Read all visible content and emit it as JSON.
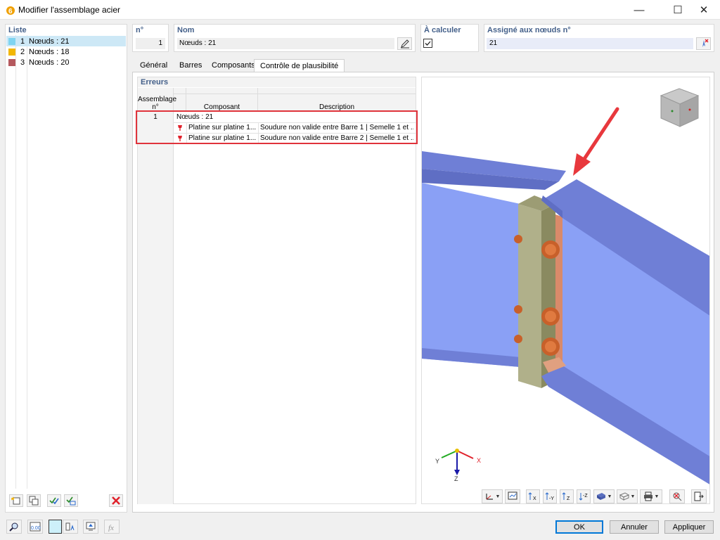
{
  "window": {
    "title": "Modifier l'assemblage acier",
    "minimize": "—",
    "maximize": "☐",
    "close": "✕"
  },
  "list": {
    "header": "Liste",
    "items": [
      {
        "num": "1",
        "label": "Nœuds : 21",
        "color": "#7fd4f0"
      },
      {
        "num": "2",
        "label": "Nœuds : 18",
        "color": "#f2b705"
      },
      {
        "num": "3",
        "label": "Nœuds : 20",
        "color": "#b5595e"
      }
    ]
  },
  "fields": {
    "num_label": "n°",
    "num_value": "1",
    "name_label": "Nom",
    "name_value": "Nœuds : 21",
    "calc_label": "À calculer",
    "assigned_label": "Assigné aux nœuds n°",
    "assigned_value": "21"
  },
  "tabs": [
    "Général",
    "Barres",
    "Composants",
    "Contrôle de plausibilité"
  ],
  "errors": {
    "title": "Erreurs",
    "col_assembly": "Assemblage n°",
    "col_assembly_l1": "Assemblage",
    "col_assembly_l2": "n°",
    "col_component": "Composant",
    "col_description": "Description",
    "rows": [
      {
        "assembly": "1",
        "group": "Nœuds : 21"
      },
      {
        "component": "Platine sur platine 1...",
        "description": "Soudure non valide entre Barre 1 | Semelle 1 et ..."
      },
      {
        "component": "Platine sur platine 1...",
        "description": "Soudure non valide entre Barre 2 | Semelle 1 et ..."
      }
    ]
  },
  "axes": {
    "x": "X",
    "y": "Y",
    "z": "Z"
  },
  "footer": {
    "ok": "OK",
    "cancel": "Annuler",
    "apply": "Appliquer"
  },
  "colors": {
    "accent_blue": "#44608a",
    "highlight_red": "#e0333b",
    "beam_blue": "#8aa0f5",
    "beam_dark": "#6f7fd6",
    "plate_olive": "#b0b08a",
    "bolt_orange": "#d2703a"
  },
  "icons": {
    "error": "error-flag-icon",
    "edit": "edit-name-icon",
    "pick": "pick-nodes-icon"
  }
}
